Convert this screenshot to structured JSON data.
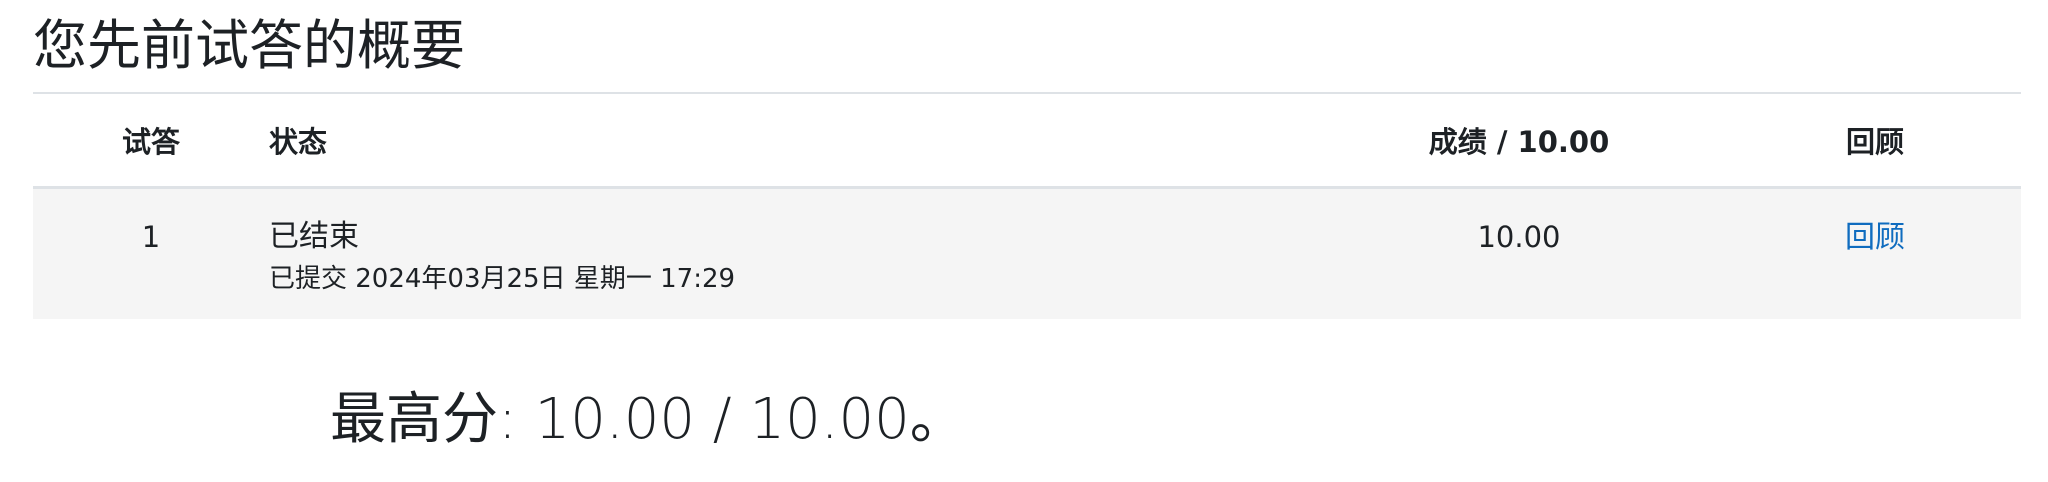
{
  "heading": "您先前试答的概要",
  "table": {
    "headers": {
      "attempt": "试答",
      "state": "状态",
      "grade": "成绩 / 10.00",
      "review": "回顾"
    },
    "rows": [
      {
        "attempt": "1",
        "state": "已结束",
        "submitted": "已提交 2024年03月25日 星期一 17:29",
        "grade": "10.00",
        "review": "回顾"
      }
    ]
  },
  "summary": "最高分: 10.00 / 10.00。",
  "colors": {
    "link": "#0f6cbf",
    "row_background": "#f5f5f5",
    "rule": "#dee2e6",
    "text": "#1d2125"
  }
}
